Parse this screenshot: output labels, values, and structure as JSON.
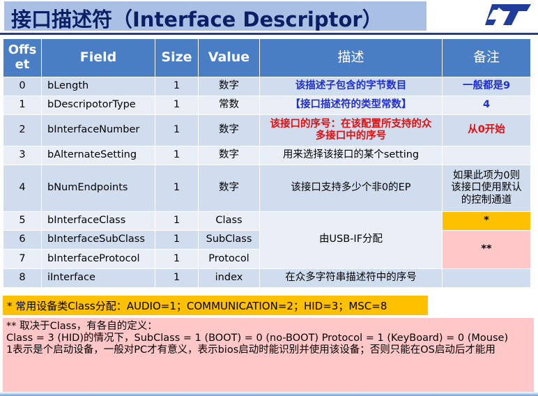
{
  "title": "接口描述符（Interface Descriptor）",
  "colors": {
    "title_band": "#a9c0e4",
    "header": "#4a7ec4",
    "row_odd": "#d0ddef",
    "row_even": "#e9eef7",
    "highlight_yellow": "#ffc000",
    "highlight_pink": "#ffc7c7",
    "blue_text": "#1f2fd6",
    "red_text": "#e01010"
  },
  "logo_icon": "st-logo",
  "table": {
    "headers": [
      "Offset",
      "Field",
      "Size",
      "Value",
      "描述",
      "备注"
    ],
    "rows": [
      {
        "offset": "0",
        "field": "bLength",
        "size": "1",
        "value": "数字",
        "desc": "该描述子包含的字节数目",
        "note": "一般都是9"
      },
      {
        "offset": "1",
        "field": "bDescripotorType",
        "size": "1",
        "value": "常数",
        "desc": "【接口描述符的类型常数】",
        "note": "4"
      },
      {
        "offset": "2",
        "field": "bInterfaceNumber",
        "size": "1",
        "value": "数字",
        "desc": "该接口的序号：在该配置所支持的众多接口中的序号",
        "note": "从0开始"
      },
      {
        "offset": "3",
        "field": "bAlternateSetting",
        "size": "1",
        "value": "数字",
        "desc": "用来选择该接口的某个setting",
        "note": ""
      },
      {
        "offset": "4",
        "field": "bNumEndpoints",
        "size": "1",
        "value": "数字",
        "desc": "该接口支持多少个非0的EP",
        "note": "如果此项为0则该接口使用默认的控制通道"
      },
      {
        "offset": "5",
        "field": "bInterfaceClass",
        "size": "1",
        "value": "Class",
        "note": "*"
      },
      {
        "offset": "6",
        "field": "bInterfaceSubClass",
        "size": "1",
        "value": "SubClass",
        "note": "**"
      },
      {
        "offset": "7",
        "field": "bInterfaceProtocol",
        "size": "1",
        "value": "Protocol"
      },
      {
        "offset": "8",
        "field": "iInterface",
        "size": "1",
        "value": "index",
        "desc": "在众多字符串描述符中的序号",
        "note": ""
      }
    ],
    "merged_desc": "由USB-IF分配"
  },
  "common_classes": "* 常用设备类Class分配：AUDIO=1；COMMUNICATION=2；HID=3；MSC=8",
  "subclass_notes": [
    "** 取决于Class，有各自的定义：",
    "Class = 3 (HID)的情况下，SubClass = 1 (BOOT) = 0 (no-BOOT) Protocol = 1 (KeyBoard) = 0 (Mouse)",
    "1表示是个启动设备，一般对PC才有意义，表示bios启动时能识别并使用该设备；否则只能在OS启动后才能用"
  ]
}
